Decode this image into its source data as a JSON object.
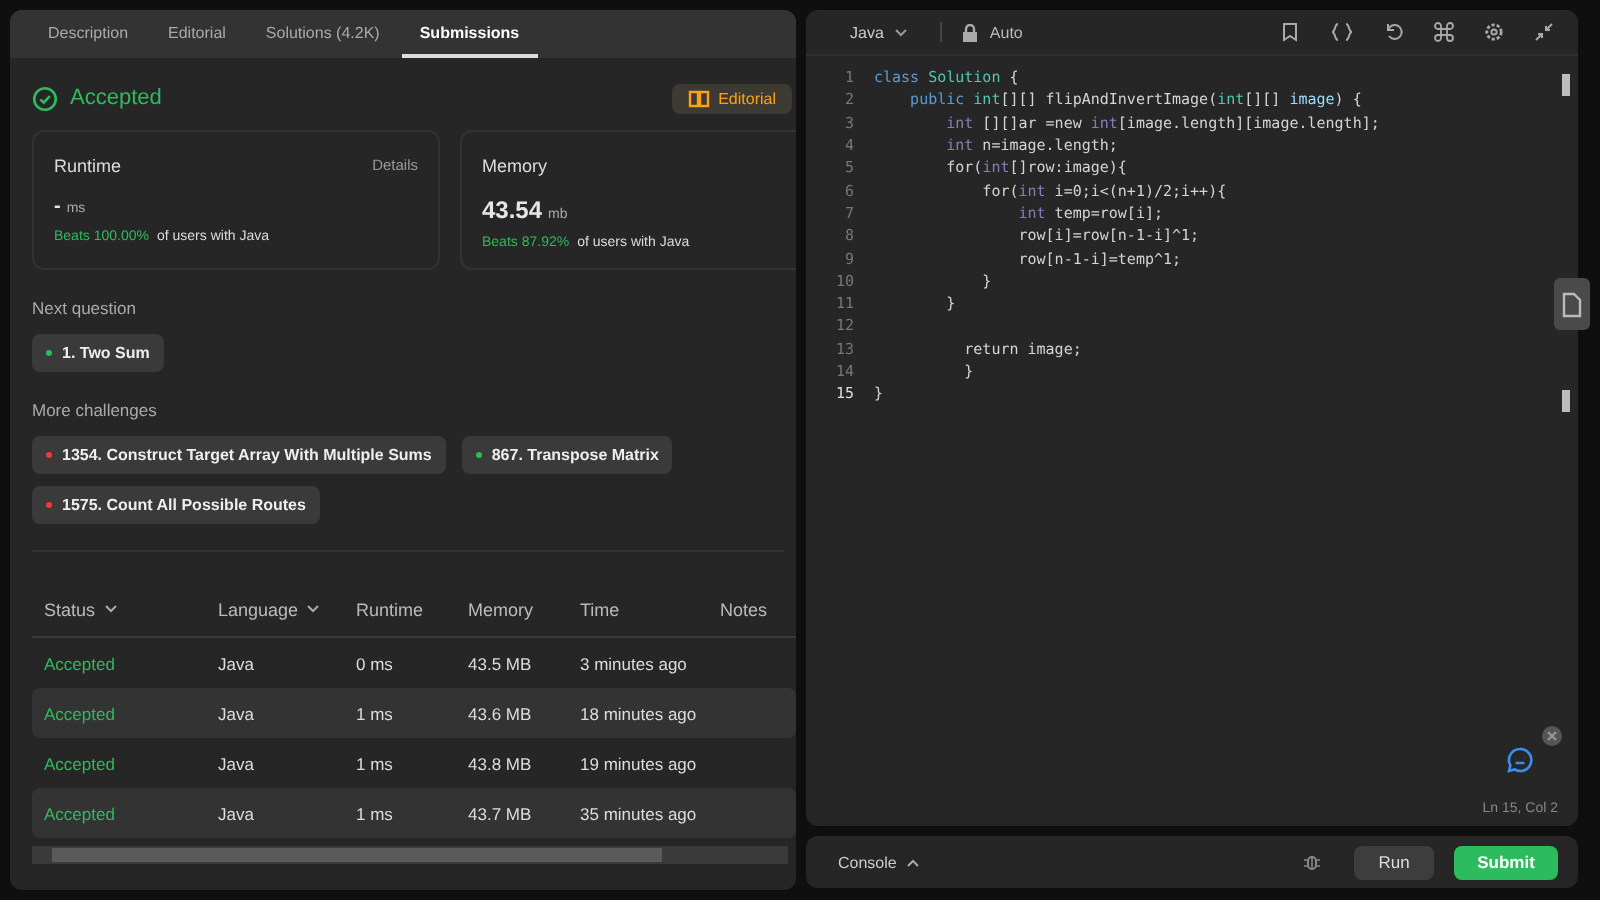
{
  "left_panel": {
    "tabs": [
      {
        "label": "Description",
        "selected": false
      },
      {
        "label": "Editorial",
        "selected": false
      },
      {
        "label": "Solutions (4.2K)",
        "selected": false
      },
      {
        "label": "Submissions",
        "selected": true
      }
    ],
    "result": {
      "status": "Accepted",
      "editorial_button": "Editorial"
    },
    "runtime_card": {
      "title": "Runtime",
      "details": "Details",
      "value": "-",
      "unit": "ms",
      "beats": "Beats 100.00%",
      "beats_suffix": "of users with Java"
    },
    "memory_card": {
      "title": "Memory",
      "value": "43.54",
      "unit": "mb",
      "beats": "Beats 87.92%",
      "beats_suffix": "of users with Java"
    },
    "next_question": {
      "heading": "Next question",
      "items": [
        {
          "label": "1. Two Sum",
          "color": "#2cbb5d"
        }
      ]
    },
    "more_challenges": {
      "heading": "More challenges",
      "items": [
        {
          "label": "1354. Construct Target Array With Multiple Sums",
          "color": "#f63636"
        },
        {
          "label": "867. Transpose Matrix",
          "color": "#2cbb5d"
        },
        {
          "label": "1575. Count All Possible Routes",
          "color": "#f63636"
        }
      ]
    },
    "table": {
      "columns": [
        {
          "label": "Status",
          "sortable": true
        },
        {
          "label": "Language",
          "sortable": true
        },
        {
          "label": "Runtime",
          "sortable": false
        },
        {
          "label": "Memory",
          "sortable": false
        },
        {
          "label": "Time",
          "sortable": false
        },
        {
          "label": "Notes",
          "sortable": false
        }
      ],
      "rows": [
        [
          "Accepted",
          "Java",
          "0 ms",
          "43.5 MB",
          "3 minutes ago"
        ],
        [
          "Accepted",
          "Java",
          "1 ms",
          "43.6 MB",
          "18 minutes ago"
        ],
        [
          "Accepted",
          "Java",
          "1 ms",
          "43.8 MB",
          "19 minutes ago"
        ],
        [
          "Accepted",
          "Java",
          "1 ms",
          "43.7 MB",
          "35 minutes ago"
        ]
      ]
    }
  },
  "editor": {
    "language": "Java",
    "mode": "Auto",
    "lines": [
      {
        "number": "1",
        "tokens": [
          {
            "kind": "kw",
            "text": "class"
          },
          {
            "kind": "cls",
            "text": " Solution"
          },
          {
            "kind": "plain",
            "text": " {"
          }
        ]
      },
      {
        "number": "2",
        "tokens": [
          {
            "kind": "kw",
            "text": "    public"
          },
          {
            "kind": "cls",
            "text": " int"
          },
          {
            "kind": "plain",
            "text": "[][] flipAndInvertImage("
          },
          {
            "kind": "cls",
            "text": "int"
          },
          {
            "kind": "plain",
            "text": "[][]"
          },
          {
            "kind": "var",
            "text": " image"
          },
          {
            "kind": "plain",
            "text": ") {"
          }
        ]
      },
      {
        "number": "3",
        "tokens": [
          {
            "kind": "type",
            "text": "        int"
          },
          {
            "kind": "plain",
            "text": " [][]ar =new "
          },
          {
            "kind": "type",
            "text": "int"
          },
          {
            "kind": "plain",
            "text": "[image.length][image.length];"
          }
        ]
      },
      {
        "number": "4",
        "tokens": [
          {
            "kind": "type",
            "text": "        int"
          },
          {
            "kind": "plain",
            "text": " n=image.length;"
          }
        ]
      },
      {
        "number": "5",
        "tokens": [
          {
            "kind": "plain",
            "text": "        for("
          },
          {
            "kind": "type",
            "text": "int"
          },
          {
            "kind": "plain",
            "text": "[]row:image){"
          }
        ]
      },
      {
        "number": "6",
        "tokens": [
          {
            "kind": "plain",
            "text": "            for("
          },
          {
            "kind": "type",
            "text": "int"
          },
          {
            "kind": "plain",
            "text": " i=0;i<(n+1)/2;i++){"
          }
        ]
      },
      {
        "number": "7",
        "tokens": [
          {
            "kind": "type",
            "text": "                int"
          },
          {
            "kind": "plain",
            "text": " temp=row[i];"
          }
        ]
      },
      {
        "number": "8",
        "tokens": [
          {
            "kind": "plain",
            "text": "                row[i]=row[n-1-i]^1;"
          }
        ]
      },
      {
        "number": "9",
        "tokens": [
          {
            "kind": "plain",
            "text": "                row[n-1-i]=temp^1;"
          }
        ]
      },
      {
        "number": "10",
        "tokens": [
          {
            "kind": "plain",
            "text": "            }"
          }
        ]
      },
      {
        "number": "11",
        "tokens": [
          {
            "kind": "plain",
            "text": "        }"
          }
        ]
      },
      {
        "number": "12"
      },
      {
        "number": "13",
        "tokens": [
          {
            "kind": "plain",
            "text": "          return image;"
          }
        ]
      },
      {
        "number": "14",
        "tokens": [
          {
            "kind": "plain",
            "text": "          }"
          }
        ]
      },
      {
        "number": "15",
        "tokens": [
          {
            "kind": "plain",
            "text": "}"
          }
        ]
      }
    ],
    "cursor": "Ln 15, Col 2"
  },
  "bottom_bar": {
    "console": "Console",
    "run": "Run",
    "submit": "Submit"
  }
}
